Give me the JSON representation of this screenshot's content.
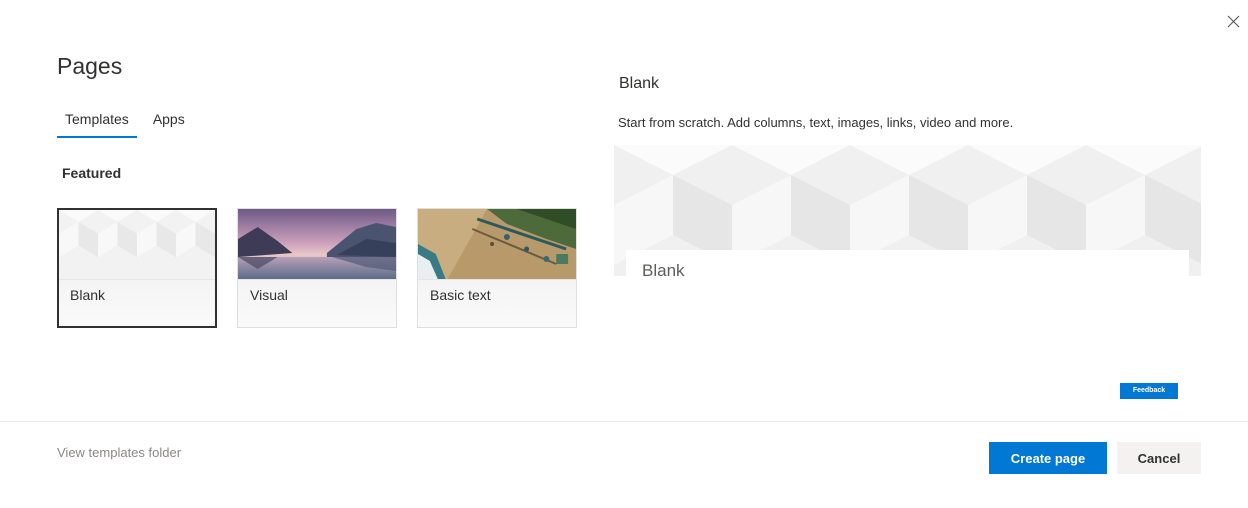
{
  "header": {
    "title": "Pages",
    "close_icon": "close-icon"
  },
  "tabs": [
    {
      "label": "Templates",
      "active": true
    },
    {
      "label": "Apps",
      "active": false
    }
  ],
  "featured": {
    "heading": "Featured",
    "cards": [
      {
        "label": "Blank",
        "selected": true
      },
      {
        "label": "Visual",
        "selected": false
      },
      {
        "label": "Basic text",
        "selected": false
      }
    ]
  },
  "preview": {
    "title": "Blank",
    "description": "Start from scratch. Add columns, text, images, links, video and more.",
    "card_title": "Blank"
  },
  "feedback_label": "Feedback",
  "footer": {
    "folder_link": "View templates folder",
    "create_label": "Create page",
    "cancel_label": "Cancel"
  },
  "colors": {
    "accent": "#0078d4",
    "text": "#323130",
    "muted": "#8a8886",
    "secondary_button": "#f3f2f1"
  }
}
